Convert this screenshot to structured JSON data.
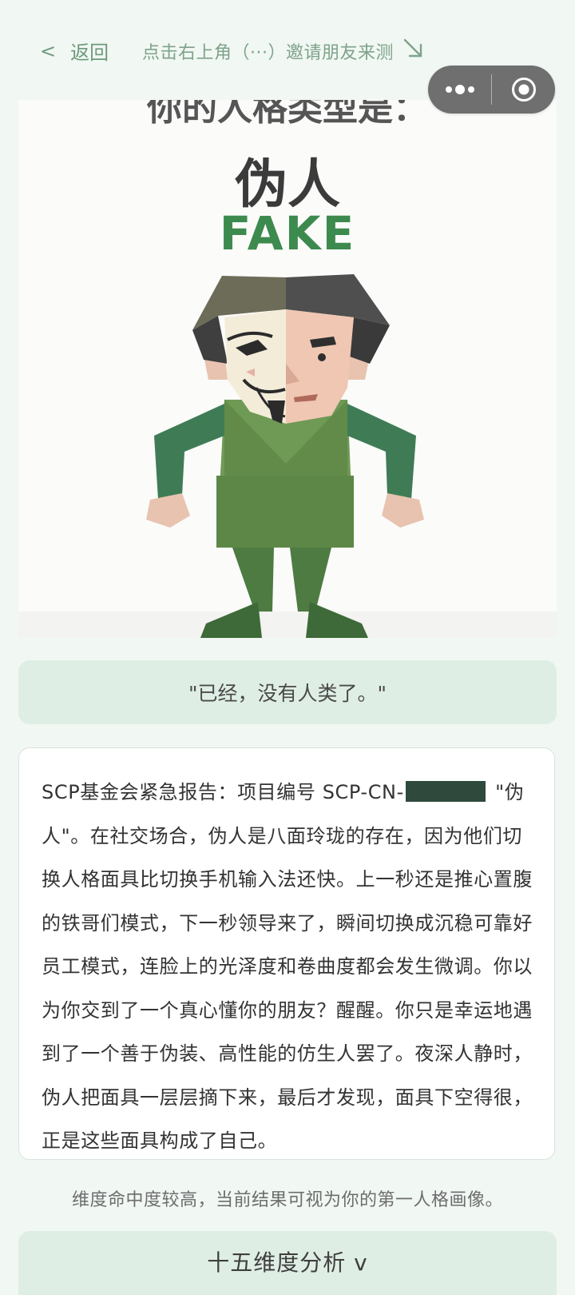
{
  "nav": {
    "back_chevron": "<",
    "back_label": "返回",
    "hint_text": "点击右上角（···）邀请朋友来测",
    "hint_icon": "arrow-down-right-icon",
    "capsule_icons": [
      "more-dots-icon",
      "close-target-icon"
    ]
  },
  "hero": {
    "partial_heading": "你的人格类型是：",
    "type_cn": "伪人",
    "type_en": "FAKE",
    "image_subject": "half-masked-figure"
  },
  "quote": "\"已经，没有人类了。\"",
  "report": {
    "lines": [
      {
        "before": "SCP基金会紧急报告：项目编号 SCP-CN-",
        "redacted": true,
        "after": " \"伪"
      },
      {
        "text": "人\"。在社交场合，伪人是八面玲珑的存在，因为他们切"
      },
      {
        "text": "换人格面具比切换手机输入法还快。上一秒还是推心置腹"
      },
      {
        "text": "的铁哥们模式，下一秒领导来了，瞬间切换成沉稳可靠好"
      },
      {
        "text": "员工模式，连脸上的光泽度和卷曲度都会发生微调。你以"
      },
      {
        "text": "为你交到了一个真心懂你的朋友？醒醒。你只是幸运地遇"
      },
      {
        "text": "到了一个善于伪装、高性能的仿生人罢了。夜深人静时，"
      },
      {
        "text": "伪人把面具一层层摘下来，最后才发现，面具下空得很，"
      },
      {
        "text": "正是这些面具构成了自己。"
      }
    ]
  },
  "note": "维度命中度较高，当前结果可视为你的第一人格画像。",
  "analysis_button": "十五维度分析 v",
  "colors": {
    "page_bg": "#f1f7f3",
    "accent_green": "#3d8a4e",
    "soft_green": "#dfeee4",
    "nav_green": "#6e9a7c",
    "capsule": "#6f6f6f"
  }
}
